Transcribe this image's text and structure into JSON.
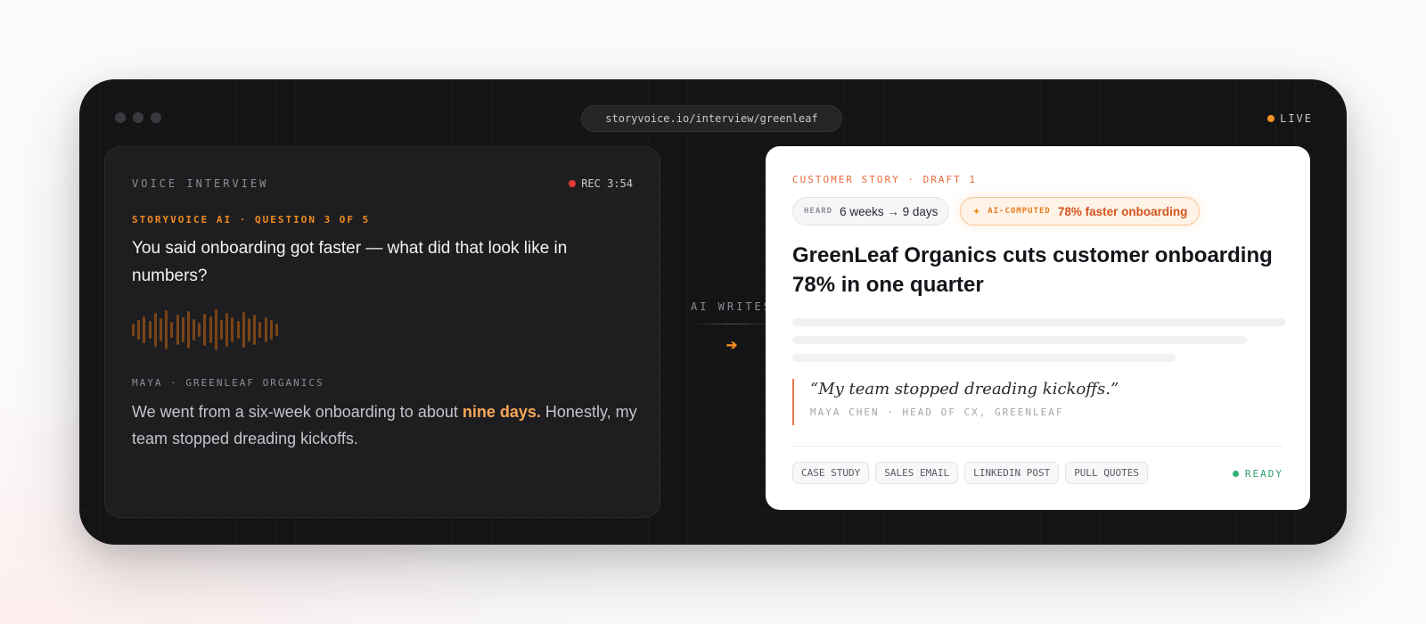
{
  "window": {
    "url": "storyvoice.io/interview/greenleaf",
    "live_label": "LIVE",
    "live_color": "#f59023"
  },
  "interview": {
    "title": "VOICE INTERVIEW",
    "rec_label": "REC 3:54",
    "ai_label": "STORYVOICE AI · QUESTION 3 OF 5",
    "question": "You said onboarding got faster — what did that look like in numbers?",
    "speaker": "MAYA · GREENLEAF ORGANICS",
    "answer_before": "We went from a six-week onboarding to about ",
    "answer_highlight": "nine days.",
    "answer_after": " Honestly, my team stopped dreading kickoffs.",
    "waveform_icon": "audio-waveform-icon"
  },
  "transition": {
    "label": "AI WRITES",
    "arrow": "➔"
  },
  "story": {
    "label": "CUSTOMER STORY · DRAFT 1",
    "heard_key": "HEARD",
    "heard_value": "6 weeks → 9 days",
    "ai_spark": "✦",
    "ai_key": "AI-COMPUTED",
    "ai_value": "78% faster onboarding",
    "headline": "GreenLeaf Organics cuts customer onboarding 78% in one quarter",
    "quote": "“My team stopped dreading kickoffs.”",
    "quote_attribution": "MAYA CHEN · HEAD OF CX, GREENLEAF",
    "tags": [
      "CASE STUDY",
      "SALES EMAIL",
      "LINKEDIN POST",
      "PULL QUOTES"
    ],
    "status": "READY",
    "status_color": "#2fb072",
    "accent_color": "#f08a1e"
  }
}
